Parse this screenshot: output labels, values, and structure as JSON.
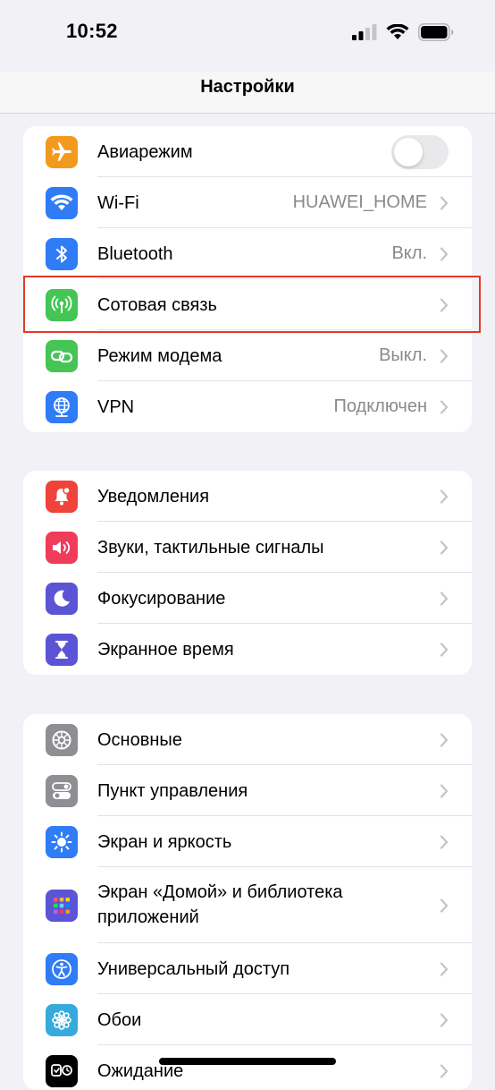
{
  "status_bar": {
    "time": "10:52",
    "icons": [
      "cellular-signal-icon",
      "wifi-icon",
      "battery-icon"
    ]
  },
  "nav": {
    "title": "Настройки"
  },
  "colors": {
    "background": "#f2f1f6",
    "orange": "#f39a1e",
    "blue": "#2f7cf6",
    "green": "#45c554",
    "red": "#f04339",
    "pink": "#ef3c5a",
    "purple": "#5b55d6",
    "gray": "#8e8e93",
    "teal": "#36aadc",
    "highlight": "#e2382a"
  },
  "groups": [
    {
      "items": [
        {
          "label": "Авиарежим",
          "icon": "airplane-icon",
          "toggle": false
        },
        {
          "label": "Wi-Fi",
          "icon": "wifi-icon",
          "value": "HUAWEI_HOME"
        },
        {
          "label": "Bluetooth",
          "icon": "bluetooth-icon",
          "value": "Вкл."
        },
        {
          "label": "Сотовая связь",
          "icon": "antenna-icon"
        },
        {
          "label": "Режим модема",
          "icon": "hotspot-chain-icon",
          "value": "Выкл."
        },
        {
          "label": "VPN",
          "icon": "globe-icon",
          "value": "Подключен"
        }
      ]
    },
    {
      "items": [
        {
          "label": "Уведомления",
          "icon": "bell-icon"
        },
        {
          "label": "Звуки, тактильные сигналы",
          "icon": "speaker-icon"
        },
        {
          "label": "Фокусирование",
          "icon": "moon-icon"
        },
        {
          "label": "Экранное время",
          "icon": "hourglass-icon"
        }
      ]
    },
    {
      "items": [
        {
          "label": "Основные",
          "icon": "gear-icon"
        },
        {
          "label": "Пункт управления",
          "icon": "switches-icon"
        },
        {
          "label": "Экран и яркость",
          "icon": "sun-icon"
        },
        {
          "label_line1": "Экран «Домой» и библиотека",
          "label_line2": "приложений",
          "icon": "app-grid-icon"
        },
        {
          "label": "Универсальный доступ",
          "icon": "accessibility-icon"
        },
        {
          "label": "Обои",
          "icon": "flower-icon"
        },
        {
          "label": "Ожидание",
          "icon": "standby-icon"
        }
      ]
    }
  ]
}
